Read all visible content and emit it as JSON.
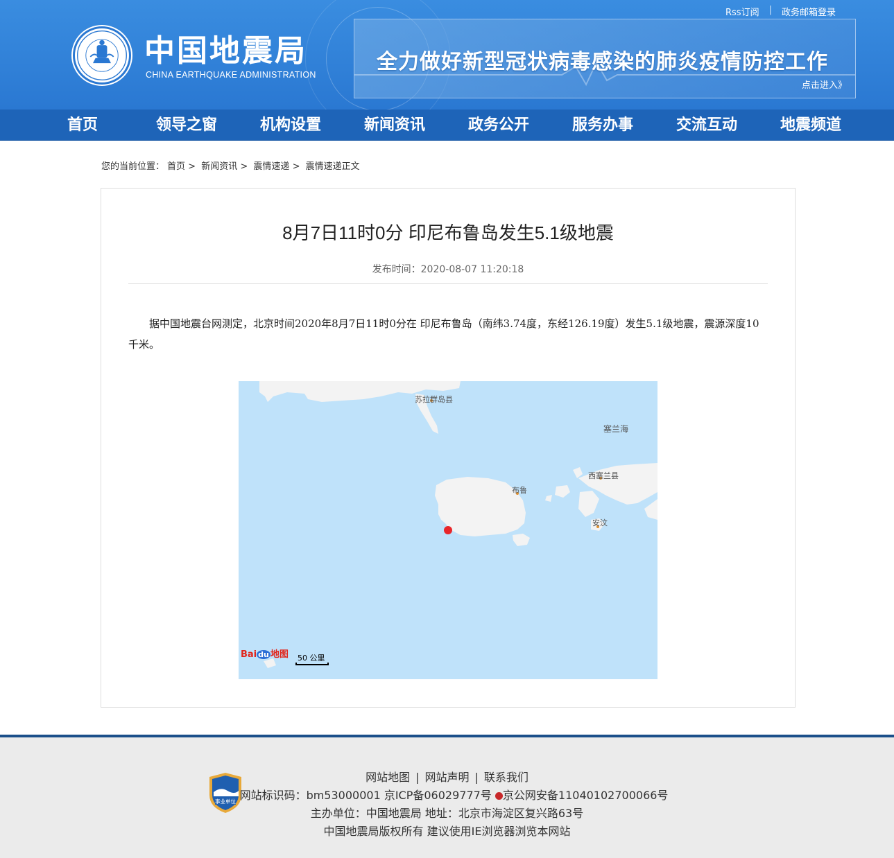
{
  "header": {
    "top_links": [
      "Rss订阅",
      "政务邮箱登录"
    ],
    "site_name": "中国地震局",
    "site_name_en": "CHINA EARTHQUAKE ADMINISTRATION",
    "banner_text": "全力做好新型冠状病毒感染的肺炎疫情防控工作",
    "banner_link": "点击进入》"
  },
  "nav": [
    "首页",
    "领导之窗",
    "机构设置",
    "新闻资讯",
    "政务公开",
    "服务办事",
    "交流互动",
    "地震频道"
  ],
  "breadcrumb": {
    "prefix": "您的当前位置：",
    "items": [
      "首页",
      "新闻资讯",
      "震情速递",
      "震情速递正文"
    ],
    "separator": ">"
  },
  "article": {
    "title": "8月7日11时0分 印尼布鲁岛发生5.1级地震",
    "pub_time": "发布时间：2020-08-07 11:20:18",
    "body": "据中国地震台网测定，北京时间2020年8月7日11时0分在 印尼布鲁岛（南纬3.74度，东经126.19度）发生5.1级地震，震源深度10千米。"
  },
  "map": {
    "labels": {
      "sula": "苏拉群岛县",
      "seram_sea": "塞兰海",
      "west_seram": "西塞兰县",
      "buru": "布鲁",
      "ambon": "安汶"
    },
    "scale": "50 公里",
    "logo": "Bai du 地图",
    "epicenter_color": "#e8262a"
  },
  "footer": {
    "links": [
      "网站地图",
      "网站声明",
      "联系我们"
    ],
    "line2": "网站标识码：bm53000001  京ICP备06029777号",
    "line2b": "京公网安备11040102700066号",
    "line3": "主办单位：中国地震局  地址：北京市海淀区复兴路63号",
    "line4": "中国地震局版权所有  建议使用IE浏览器浏览本网站",
    "badge_text": "事业单位"
  }
}
